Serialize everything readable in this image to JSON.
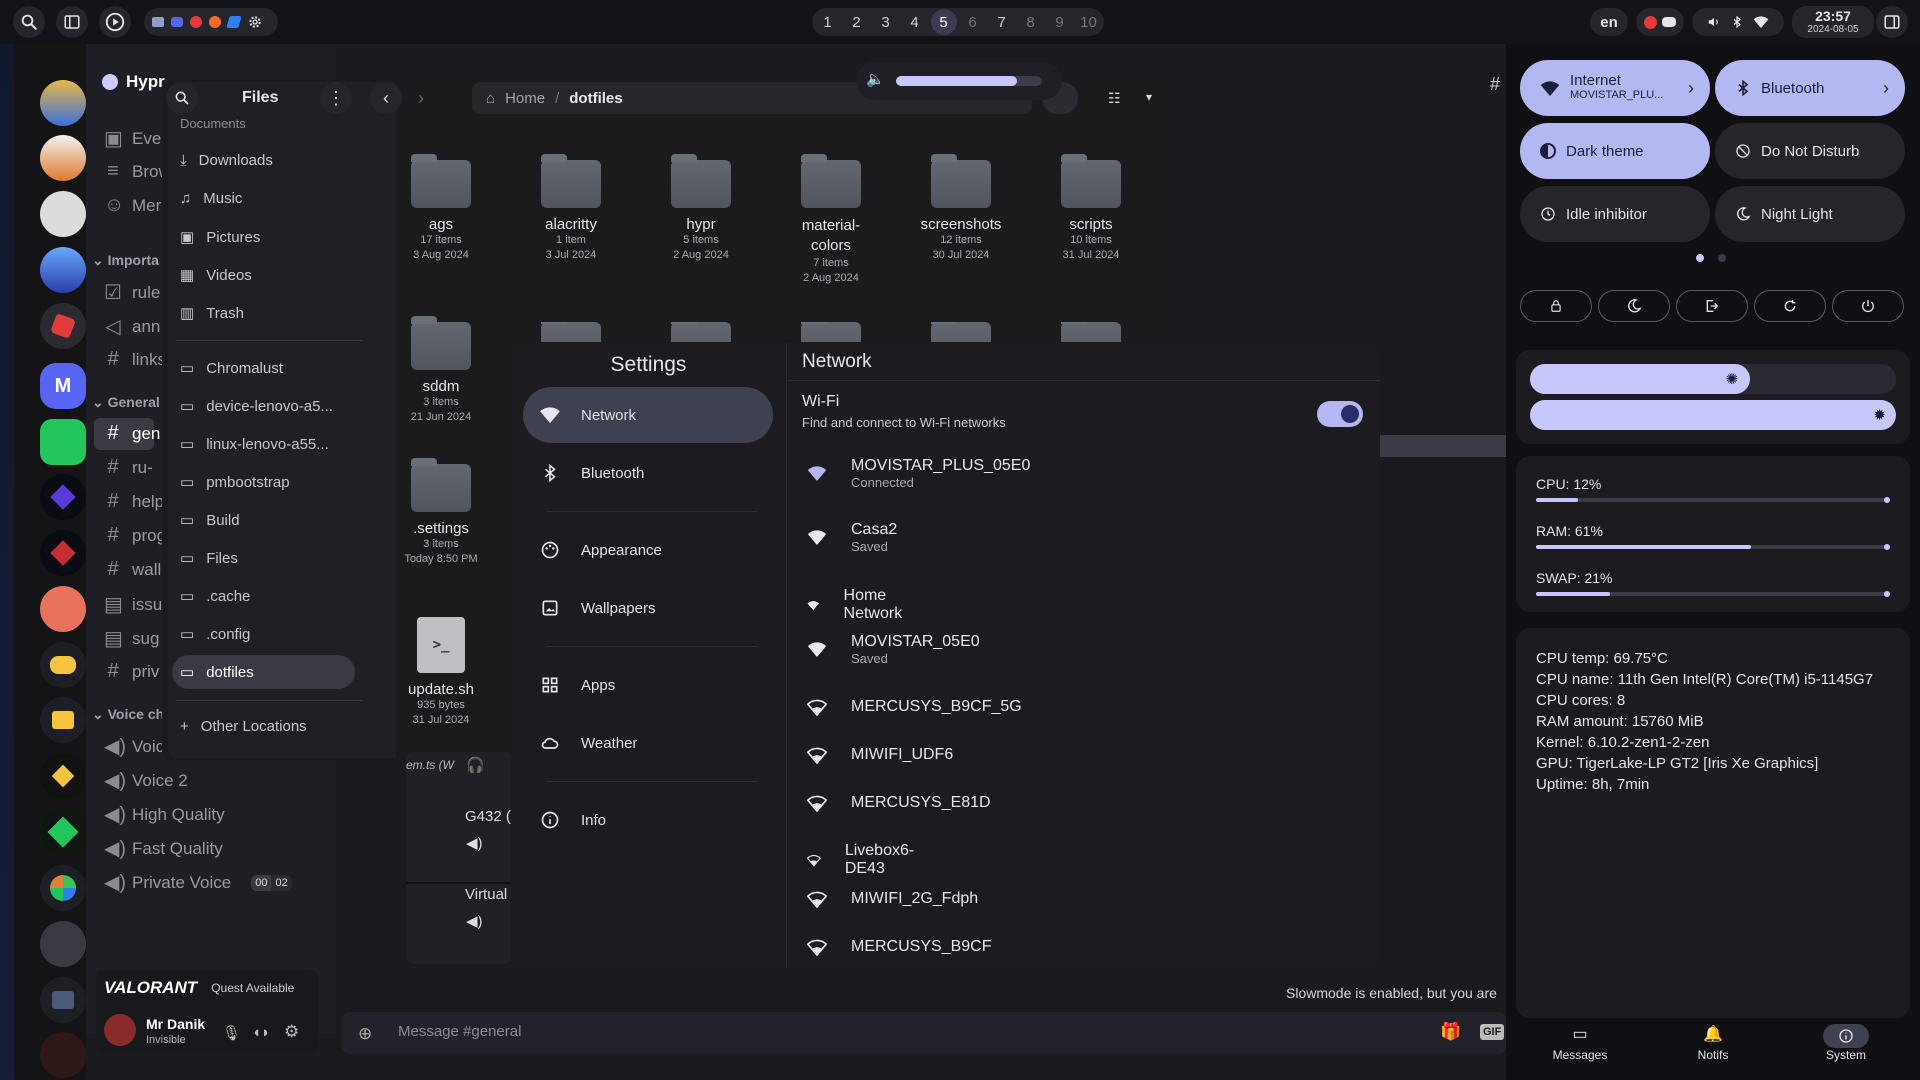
{
  "topbar": {
    "workspaces": [
      "1",
      "2",
      "3",
      "4",
      "5",
      "6",
      "7",
      "8",
      "9",
      "10"
    ],
    "active_workspace": "5",
    "language": "en",
    "time": "23:57",
    "date": "2024-08-05"
  },
  "discord": {
    "server_name": "Hypr",
    "channels_top": [
      "Eve",
      "Brow",
      "Mer"
    ],
    "category_important": "Importa",
    "important_channels": [
      "rule",
      "ann",
      "links"
    ],
    "category_general": "General",
    "general_channels": [
      "gen",
      "ru-",
      "help",
      "prog",
      "wall",
      "issu",
      "sug",
      "priv"
    ],
    "category_voice": "Voice ch",
    "voice_channels": [
      "Voic",
      "Voice 2",
      "High Quality",
      "Fast Quality",
      "Private Voice"
    ],
    "private_voice_counts": [
      "00",
      "02"
    ],
    "activity_game": "VALORANT",
    "activity_text": "Quest Available",
    "user_name": "Mr Danik",
    "user_status": "Invisible",
    "message_placeholder": "Message #general",
    "slowmode_text": "Slowmode is enabled, but you are",
    "guild_letter": "M"
  },
  "files": {
    "title": "Files",
    "breadcrumb": [
      "Home",
      "dotfiles"
    ],
    "sidebar": [
      "Documents",
      "Downloads",
      "Music",
      "Pictures",
      "Videos",
      "Trash",
      "Chromalust",
      "device-lenovo-a5...",
      "linux-lenovo-a55...",
      "pmbootstrap",
      "Build",
      "Files",
      ".cache",
      ".config",
      "dotfiles"
    ],
    "selected_sidebar": "dotfiles",
    "other_locations": "Other Locations",
    "items": [
      {
        "name": "ags",
        "info": "17 items",
        "date": "3 Aug 2024"
      },
      {
        "name": "alacritty",
        "info": "1 item",
        "date": "3 Jul 2024"
      },
      {
        "name": "hypr",
        "info": "5 items",
        "date": "2 Aug 2024"
      },
      {
        "name": "material-\ncolors",
        "info": "7 items",
        "date": "2 Aug 2024"
      },
      {
        "name": "screenshots",
        "info": "12 items",
        "date": "30 Jul 2024"
      },
      {
        "name": "scripts",
        "info": "10 items",
        "date": "31 Jul 2024"
      },
      {
        "name": "sddm",
        "info": "3 items",
        "date": "21 Jun 2024"
      },
      {
        "name": ".settings",
        "info": "3 items",
        "date": "Today 8:50 PM"
      },
      {
        "name": "update.sh",
        "info": "935 bytes",
        "date": "31 Jul 2024"
      }
    ]
  },
  "volume_popup": {
    "level_fraction": 0.83
  },
  "mixer": {
    "partial_text": "em.ts (W",
    "device_1": "G432 (",
    "device_2": "Virtual"
  },
  "settings": {
    "title": "Settings",
    "nav": [
      "Network",
      "Bluetooth",
      "Appearance",
      "Wallpapers",
      "Apps",
      "Weather",
      "Info"
    ],
    "active_nav": "Network",
    "page_title": "Network",
    "wifi_title": "Wi-Fi",
    "wifi_subtitle": "Find and connect to Wi-Fi networks",
    "wifi_enabled": true,
    "networks": [
      {
        "name": "MOVISTAR_PLUS_05E0",
        "status": "Connected"
      },
      {
        "name": "Casa2",
        "status": "Saved"
      },
      {
        "name": "Home Network",
        "status": ""
      },
      {
        "name": "MOVISTAR_05E0",
        "status": "Saved"
      },
      {
        "name": "MERCUSYS_B9CF_5G",
        "status": ""
      },
      {
        "name": "MIWIFI_UDF6",
        "status": ""
      },
      {
        "name": "MERCUSYS_E81D",
        "status": ""
      },
      {
        "name": "Livebox6-DE43",
        "status": ""
      },
      {
        "name": "MIWIFI_2G_Fdph",
        "status": ""
      },
      {
        "name": "MERCUSYS_B9CF",
        "status": ""
      }
    ]
  },
  "sidepanel": {
    "tiles": {
      "internet": {
        "label": "Internet",
        "sub": "MOVISTAR_PLU..."
      },
      "bluetooth": {
        "label": "Bluetooth"
      },
      "dark_theme": {
        "label": "Dark theme"
      },
      "dnd": {
        "label": "Do Not Disturb"
      },
      "idle": {
        "label": "Idle inhibitor"
      },
      "night": {
        "label": "Night Light"
      }
    },
    "brightness_fraction": 0.6,
    "stats": [
      {
        "label": "CPU: 12%",
        "value": 0.12
      },
      {
        "label": "RAM: 61%",
        "value": 0.61
      },
      {
        "label": "SWAP: 21%",
        "value": 0.21
      }
    ],
    "sysinfo": [
      "CPU temp: 69.75°C",
      "CPU name: 11th Gen Intel(R) Core(TM) i5-1145G7",
      "CPU cores: 8",
      "RAM amount: 15760 MiB",
      "Kernel: 6.10.2-zen1-2-zen",
      "GPU: TigerLake-LP GT2 [Iris Xe Graphics]",
      "Uptime: 8h, 7min"
    ],
    "tabs": [
      "Messages",
      "Notifs",
      "System"
    ],
    "active_tab": "System"
  },
  "colors": {
    "accent": "#b4b8f2",
    "surface": "#1c1b20",
    "active_nav": "#3f4050"
  }
}
